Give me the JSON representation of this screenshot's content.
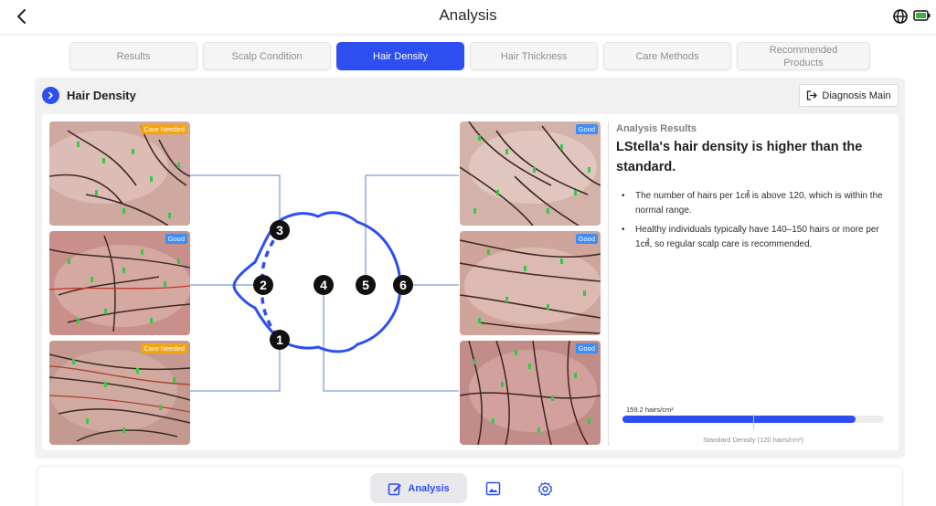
{
  "header": {
    "title": "Analysis",
    "back_icon": "chevron-left-icon",
    "language_icon": "globe-icon",
    "battery_icon": "battery-icon"
  },
  "tabs": [
    {
      "label": "Results",
      "active": false
    },
    {
      "label": "Scalp Condition",
      "active": false
    },
    {
      "label": "Hair Density",
      "active": true
    },
    {
      "label": "Hair Thickness",
      "active": false
    },
    {
      "label": "Care Methods",
      "active": false
    },
    {
      "label": "Recommended Products",
      "active": false
    }
  ],
  "panel": {
    "title": "Hair Density",
    "icon": "chevron-right-circle-icon",
    "diagnosis_button": "Diagnosis Main",
    "diagnosis_icon": "exit-icon"
  },
  "photos": {
    "left": [
      {
        "badge": "Care Needed",
        "status": "warn"
      },
      {
        "badge": "Good",
        "status": "good"
      },
      {
        "badge": "Care Needed",
        "status": "warn"
      }
    ],
    "right": [
      {
        "badge": "Good",
        "status": "good"
      },
      {
        "badge": "Good",
        "status": "good"
      },
      {
        "badge": "Good",
        "status": "good"
      }
    ]
  },
  "points": {
    "p1": "1",
    "p2": "2",
    "p3": "3",
    "p4": "4",
    "p5": "5",
    "p6": "6"
  },
  "results": {
    "label": "Analysis Results",
    "headline": "LStella's hair density is higher than the standard.",
    "bullets": [
      "The number of hairs per 1㎠ is above 120, which is within the normal range.",
      "Healthy individuals typically have 140–150 hairs or more per 1㎠, so regular scalp care is recommended."
    ],
    "measurement": "159.2 hairs/cm²",
    "measurement_fraction": 0.89,
    "standard_fraction": 0.5,
    "standard_label": "Standard Density (120 hairs/cm²)"
  },
  "bottom_nav": {
    "analysis_label": "Analysis",
    "analysis_icon": "edit-document-icon",
    "gallery_icon": "image-icon",
    "settings_icon": "gear-icon"
  },
  "colors": {
    "accent": "#2d4ef0",
    "warn_badge": "#f2a413",
    "good_badge": "#3d8df4"
  }
}
